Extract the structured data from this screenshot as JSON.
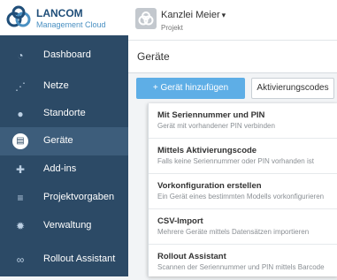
{
  "brand": {
    "name": "LANCOM",
    "sub": "Management Cloud"
  },
  "project": {
    "name": "Kanzlei Meier",
    "caret": "▾",
    "sub": "Projekt"
  },
  "nav": [
    {
      "label": "Dashboard",
      "icon": "dashboard-icon",
      "glyph": "◔"
    },
    {
      "label": "Netze",
      "icon": "network-icon",
      "glyph": "⋰"
    },
    {
      "label": "Standorte",
      "icon": "location-pin-icon",
      "glyph": "●"
    },
    {
      "label": "Geräte",
      "icon": "device-icon",
      "glyph": "▤"
    },
    {
      "label": "Add-ins",
      "icon": "puzzle-icon",
      "glyph": "✚"
    },
    {
      "label": "Projektvorgaben",
      "icon": "sliders-icon",
      "glyph": "≡"
    },
    {
      "label": "Verwaltung",
      "icon": "gear-icon",
      "glyph": "✹"
    },
    {
      "label": "Rollout Assistant",
      "icon": "rollout-icon",
      "glyph": "∞"
    }
  ],
  "active_nav": "Geräte",
  "page": {
    "title": "Geräte"
  },
  "buttons": {
    "add": "+ Gerät hinzufügen",
    "activation": "Aktivierungscodes"
  },
  "menu": [
    {
      "title": "Mit Seriennummer und PIN",
      "desc": "Gerät mit vorhandener PIN verbinden"
    },
    {
      "title": "Mittels Aktivierungscode",
      "desc": "Falls keine Seriennummer oder PIN vorhanden ist"
    },
    {
      "title": "Vorkonfiguration erstellen",
      "desc": "Ein Gerät eines bestimmten Modells vorkonfigurieren"
    },
    {
      "title": "CSV-Import",
      "desc": "Mehrere Geräte mittels Datensätzen importieren"
    },
    {
      "title": "Rollout Assistant",
      "desc": "Scannen der Seriennummer und PIN mittels Barcode"
    }
  ],
  "colors": {
    "sidebar": "#2c4a66",
    "accent": "#5eaee6",
    "brand": "#1f4e79"
  }
}
